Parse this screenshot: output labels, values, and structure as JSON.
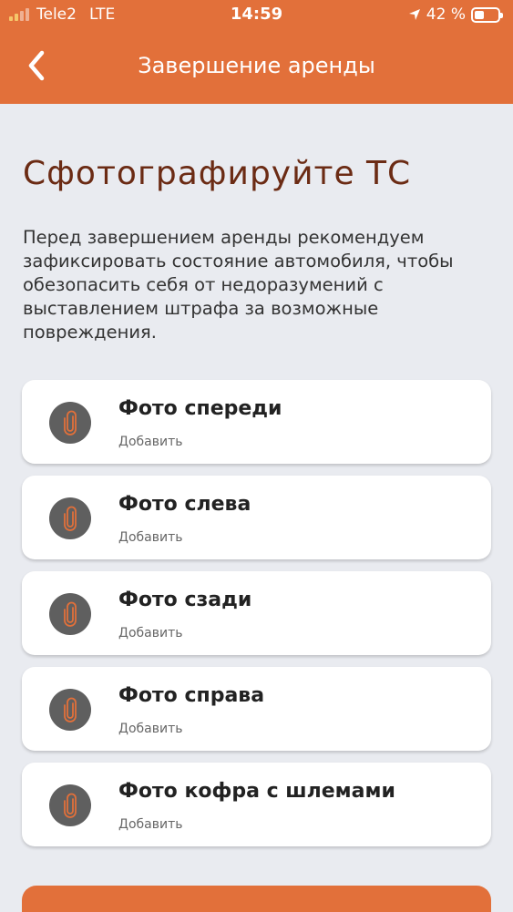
{
  "status_bar": {
    "carrier": "Tele2",
    "network": "LTE",
    "time": "14:59",
    "battery_text": "42 %",
    "battery_level": 0.42
  },
  "nav": {
    "title": "Завершение аренды",
    "back_icon": "chevron-left-icon"
  },
  "main": {
    "title": "Сфотографируйте ТС",
    "description": "Перед завершением аренды рекомендуем зафиксировать состояние автомобиля, чтобы обезопасить себя от недоразумений с выставлением штрафа за возможные повреждения."
  },
  "photos": [
    {
      "title": "Фото спереди",
      "action": "Добавить"
    },
    {
      "title": "Фото слева",
      "action": "Добавить"
    },
    {
      "title": "Фото сзади",
      "action": "Добавить"
    },
    {
      "title": "Фото справа",
      "action": "Добавить"
    },
    {
      "title": "Фото кофра с шлемами",
      "action": "Добавить"
    }
  ],
  "colors": {
    "accent": "#e2703a",
    "title": "#6b2b14",
    "background": "#e9ebf0"
  }
}
